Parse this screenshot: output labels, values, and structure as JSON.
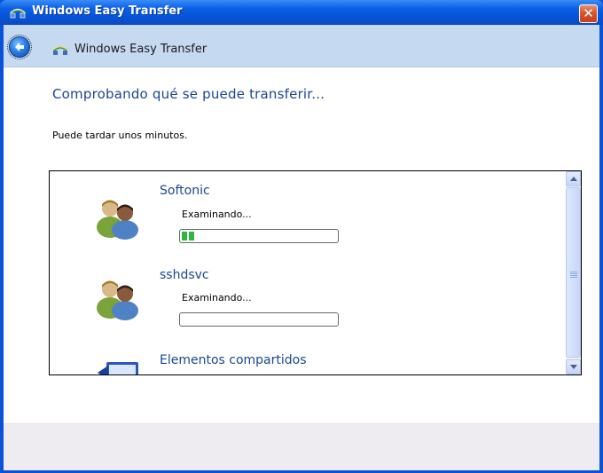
{
  "window": {
    "title": "Windows Easy Transfer",
    "close_glyph": "✕"
  },
  "navbar": {
    "title": "Windows Easy Transfer"
  },
  "main": {
    "heading": "Comprobando qué se puede transferir...",
    "subtext": "Puede tardar unos minutos."
  },
  "items": [
    {
      "name": "Softonic",
      "status": "Examinando...",
      "progress": 0.08,
      "icon": "users-icon"
    },
    {
      "name": "sshdsvc",
      "status": "Examinando...",
      "progress": 0.0,
      "icon": "users-icon"
    },
    {
      "name": "Elementos compartidos",
      "icon": "shared-computer-icon"
    }
  ],
  "colors": {
    "titlebar": "#0a5fe6",
    "navbar": "#c5d9f1",
    "heading": "#1a4790",
    "progress_fill": "#2fb63c",
    "footer": "#efecf1"
  }
}
